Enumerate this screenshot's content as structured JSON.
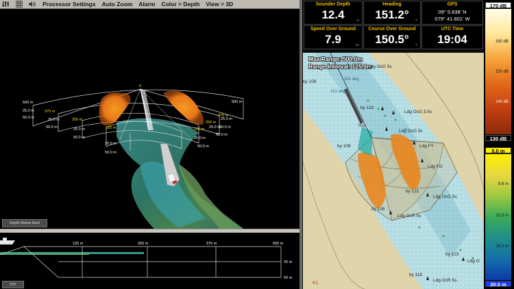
{
  "menu": {
    "icons": [
      "sliders-icon",
      "grid-icon",
      "sound-icon"
    ],
    "items": [
      "Processor Settings",
      "Auto Zoom",
      "Alarm",
      "Color = Depth",
      "View = 3D"
    ]
  },
  "view3d": {
    "range_labels": {
      "ring_500": "500 m",
      "left_lower": [
        "25.0 m",
        "50.0 m"
      ],
      "left_inner": [
        "375 m",
        "25.0 m",
        "50.0 m"
      ],
      "center_left": [
        "250 m",
        "25.0 m",
        "50.0 m"
      ],
      "center": [
        "125 m",
        "25.0 m",
        "50.0 m"
      ],
      "right_top": "125 m",
      "right_inner": [
        "25.0 m",
        "50.0 m"
      ],
      "right_250": [
        "250 m",
        "25.0 m",
        "50.0 m"
      ],
      "right_375": [
        "375 m",
        "25.0 m",
        "50.0 m"
      ],
      "right_500": "500 m",
      "apex": "0"
    },
    "depth_button": "Depth Below Keel"
  },
  "profile": {
    "ticks": [
      "125 m",
      "250 m",
      "375 m",
      "500 m"
    ],
    "depth_ticks": [
      "25 m",
      "50 m"
    ],
    "pip_button": "PIP"
  },
  "tiles": {
    "sounder_depth": {
      "label": "Sounder Depth",
      "value": "12.4",
      "unit": "m"
    },
    "heading": {
      "label": "Heading",
      "value": "151.2°",
      "unit": "T"
    },
    "gps": {
      "label": "GPS",
      "lat": "09° 5.638' N",
      "lon": "079° 41.601' W"
    },
    "sog": {
      "label": "Speed Over Ground",
      "value": "7.9",
      "unit": "kn"
    },
    "cog": {
      "label": "Course Over Ground",
      "value": "150.5°",
      "unit": "T"
    },
    "utc": {
      "label": "UTC Time",
      "value": "19:04"
    }
  },
  "chart": {
    "overlay_line1": "Max Range: 500.0m",
    "overlay_line2": "Range Interval: 125.0m",
    "lights": [
      "Ldg OcG 5s",
      "Ldg OcG 3.5s",
      "Ldg OcG 5s",
      "Ldg FY",
      "Ldg FG",
      "Ldg OcG 5s",
      "Ldg OcR 5s",
      "Ldg O",
      "Ldg OcR 5s"
    ],
    "buoys": [
      "by 106",
      "by 118",
      "by 108",
      "by 121",
      "by 108",
      "by 123",
      "by 118"
    ],
    "track_labels": [
      "151 deg",
      "331 deg"
    ],
    "ship_label": "Ship",
    "corner_mark": "K1"
  },
  "scale": {
    "top_db": "170 dB",
    "bottom_db": "130 dB",
    "db_ticks": [
      "160 dB",
      "150 dB",
      "140 dB"
    ],
    "depth_top": "5.0 m",
    "depth_ticks": [
      "8.8 m",
      "12.5 m",
      "16.2 m"
    ],
    "depth_bottom": "20.0 m"
  },
  "colors": {
    "accent_yellow": "#f0c000",
    "chart_land": "#e0d4ab",
    "channel_water": "#9ed0dc"
  }
}
